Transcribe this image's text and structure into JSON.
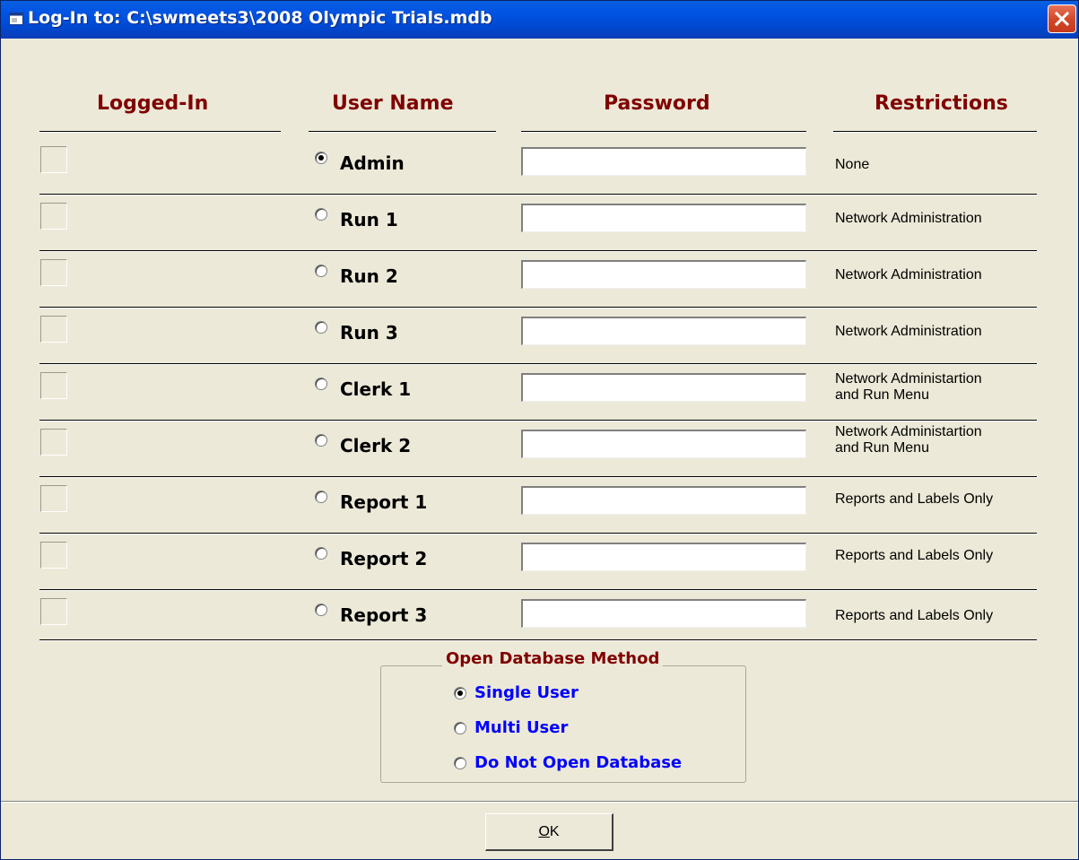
{
  "window": {
    "title": "Log-In to:  C:\\swmeets3\\2008 Olympic Trials.mdb"
  },
  "headers": {
    "logged_in": "Logged-In",
    "user_name": "User Name",
    "password": "Password",
    "restrictions": "Restrictions"
  },
  "users": [
    {
      "name": "Admin",
      "selected": true,
      "logged_in": false,
      "password": "",
      "restriction": "None"
    },
    {
      "name": "Run 1",
      "selected": false,
      "logged_in": false,
      "password": "",
      "restriction": "Network Administration"
    },
    {
      "name": "Run 2",
      "selected": false,
      "logged_in": false,
      "password": "",
      "restriction": "Network Administration"
    },
    {
      "name": "Run 3",
      "selected": false,
      "logged_in": false,
      "password": "",
      "restriction": "Network Administration"
    },
    {
      "name": "Clerk 1",
      "selected": false,
      "logged_in": false,
      "password": "",
      "restriction_line1": "Network Administartion",
      "restriction_line2": "and Run Menu"
    },
    {
      "name": "Clerk 2",
      "selected": false,
      "logged_in": false,
      "password": "",
      "restriction_line1": "Network Administartion",
      "restriction_line2": "and Run Menu"
    },
    {
      "name": "Report 1",
      "selected": false,
      "logged_in": false,
      "password": "",
      "restriction": "Reports and Labels Only"
    },
    {
      "name": "Report 2",
      "selected": false,
      "logged_in": false,
      "password": "",
      "restriction": "Reports and Labels Only"
    },
    {
      "name": "Report 3",
      "selected": false,
      "logged_in": false,
      "password": "",
      "restriction": "Reports and Labels Only"
    }
  ],
  "open_method": {
    "label": "Open Database Method",
    "options": [
      {
        "label": "Single User",
        "selected": true
      },
      {
        "label": "Multi User",
        "selected": false
      },
      {
        "label": "Do Not Open Database",
        "selected": false
      }
    ]
  },
  "buttons": {
    "ok_accel": "O",
    "ok_rest": "K"
  },
  "colors": {
    "header": "#800000",
    "option_text": "#0000ff",
    "dialog_bg": "#ece9d8",
    "titlebar": "#0054e3"
  },
  "icons": {
    "title": "window-icon",
    "close": "close-x-icon"
  }
}
